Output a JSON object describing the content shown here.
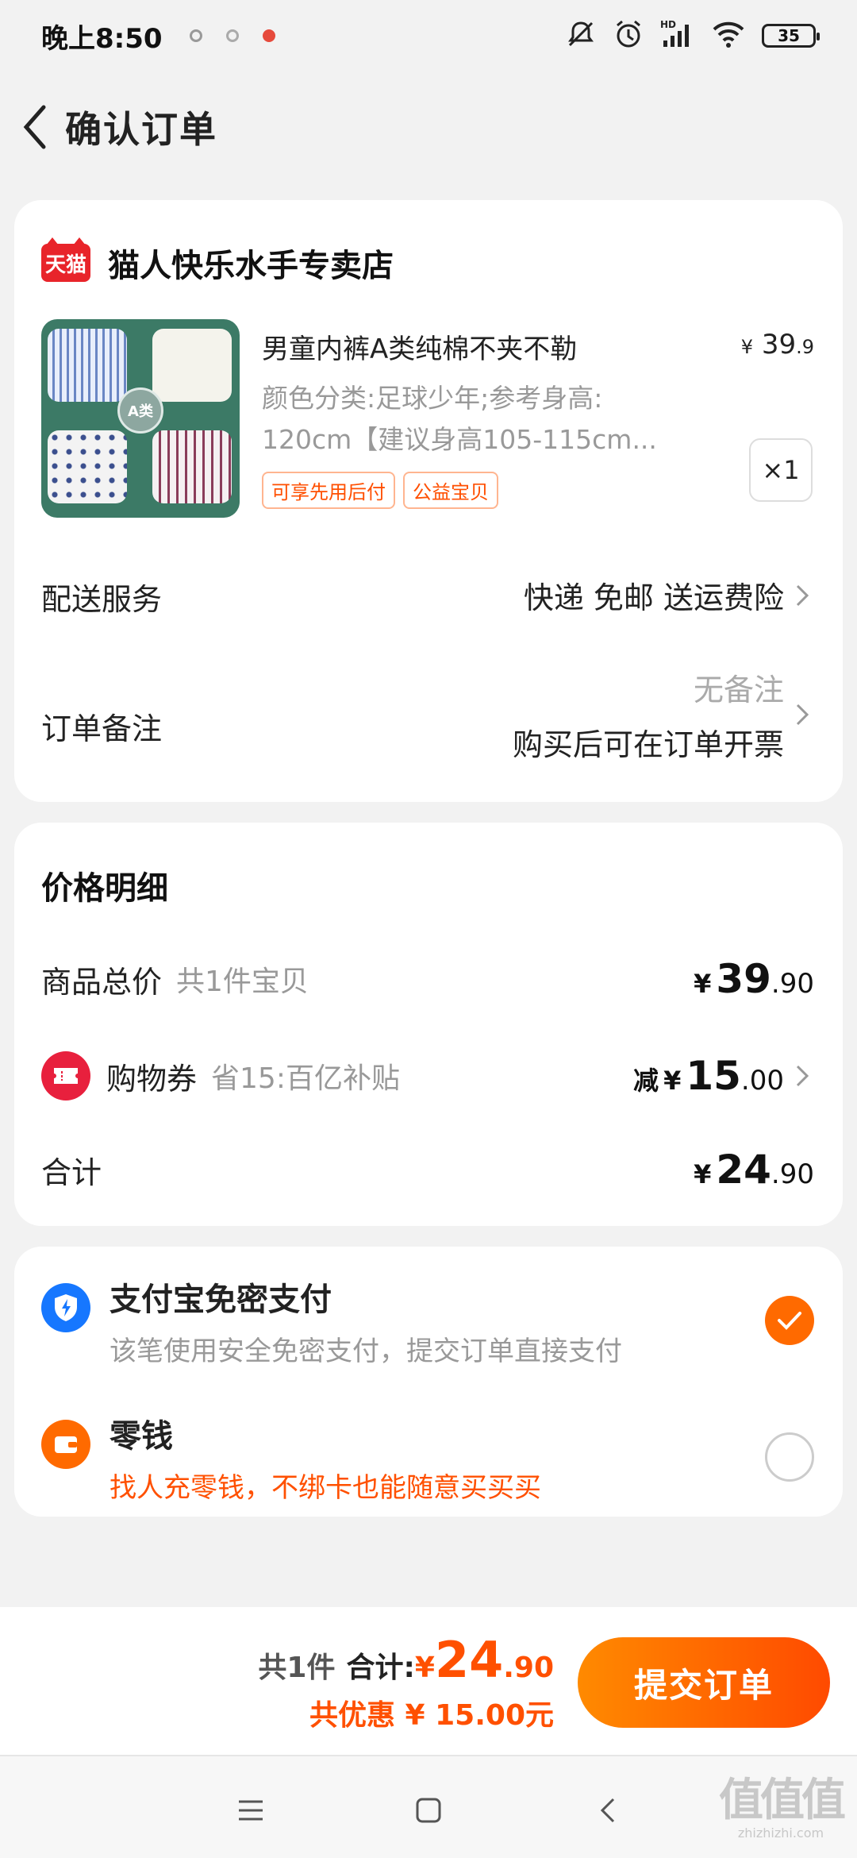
{
  "status_bar": {
    "time": "晚上8:50",
    "battery": "35"
  },
  "header": {
    "title": "确认订单"
  },
  "store": {
    "logo_text": "天猫",
    "name": "猫人快乐水手专卖店"
  },
  "product": {
    "title": "男童内裤A类纯棉不夹不勒",
    "price_symbol": "¥",
    "price_int": "39",
    "price_dec": ".9",
    "spec_line1": "颜色分类:足球少年;参考身高:",
    "spec_line2": "120cm【建议身高105-115cm...",
    "tags": [
      "可享先用后付",
      "公益宝贝"
    ],
    "quantity": "×1",
    "thumb_badge": "A类"
  },
  "delivery": {
    "label": "配送服务",
    "value": "快递 免邮 送运费险"
  },
  "note": {
    "label": "订单备注",
    "empty_text": "无备注",
    "invoice_text": "购买后可在订单开票"
  },
  "price_detail": {
    "title": "价格明细",
    "goods_label": "商品总价",
    "goods_count": "共1件宝贝",
    "goods_cur": "¥",
    "goods_int": "39",
    "goods_dec": ".90",
    "coupon_label": "购物券",
    "coupon_desc": "省15:百亿补贴",
    "coupon_prefix": "减",
    "coupon_cur": "¥",
    "coupon_int": "15",
    "coupon_dec": ".00",
    "total_label": "合计",
    "total_cur": "¥",
    "total_int": "24",
    "total_dec": ".90"
  },
  "payment": {
    "methods": [
      {
        "name": "支付宝免密支付",
        "desc": "该笔使用安全免密支付，提交订单直接支付",
        "selected": true
      },
      {
        "name": "零钱",
        "desc": "找人充零钱，不绑卡也能随意买买买",
        "selected": false
      }
    ]
  },
  "action_bar": {
    "count": "共1件",
    "total_label": "合计:",
    "total_cur": "¥",
    "total_int": "24",
    "total_dec": ".90",
    "saving": "共优惠 ¥ 15.00元",
    "submit": "提交订单"
  },
  "watermark": {
    "big": "值值值",
    "small": "zhizhizhi.com"
  },
  "colors": {
    "accent": "#ff5000",
    "tmall": "#e8242a",
    "alipay": "#1677ff",
    "wallet": "#ff6a00"
  }
}
